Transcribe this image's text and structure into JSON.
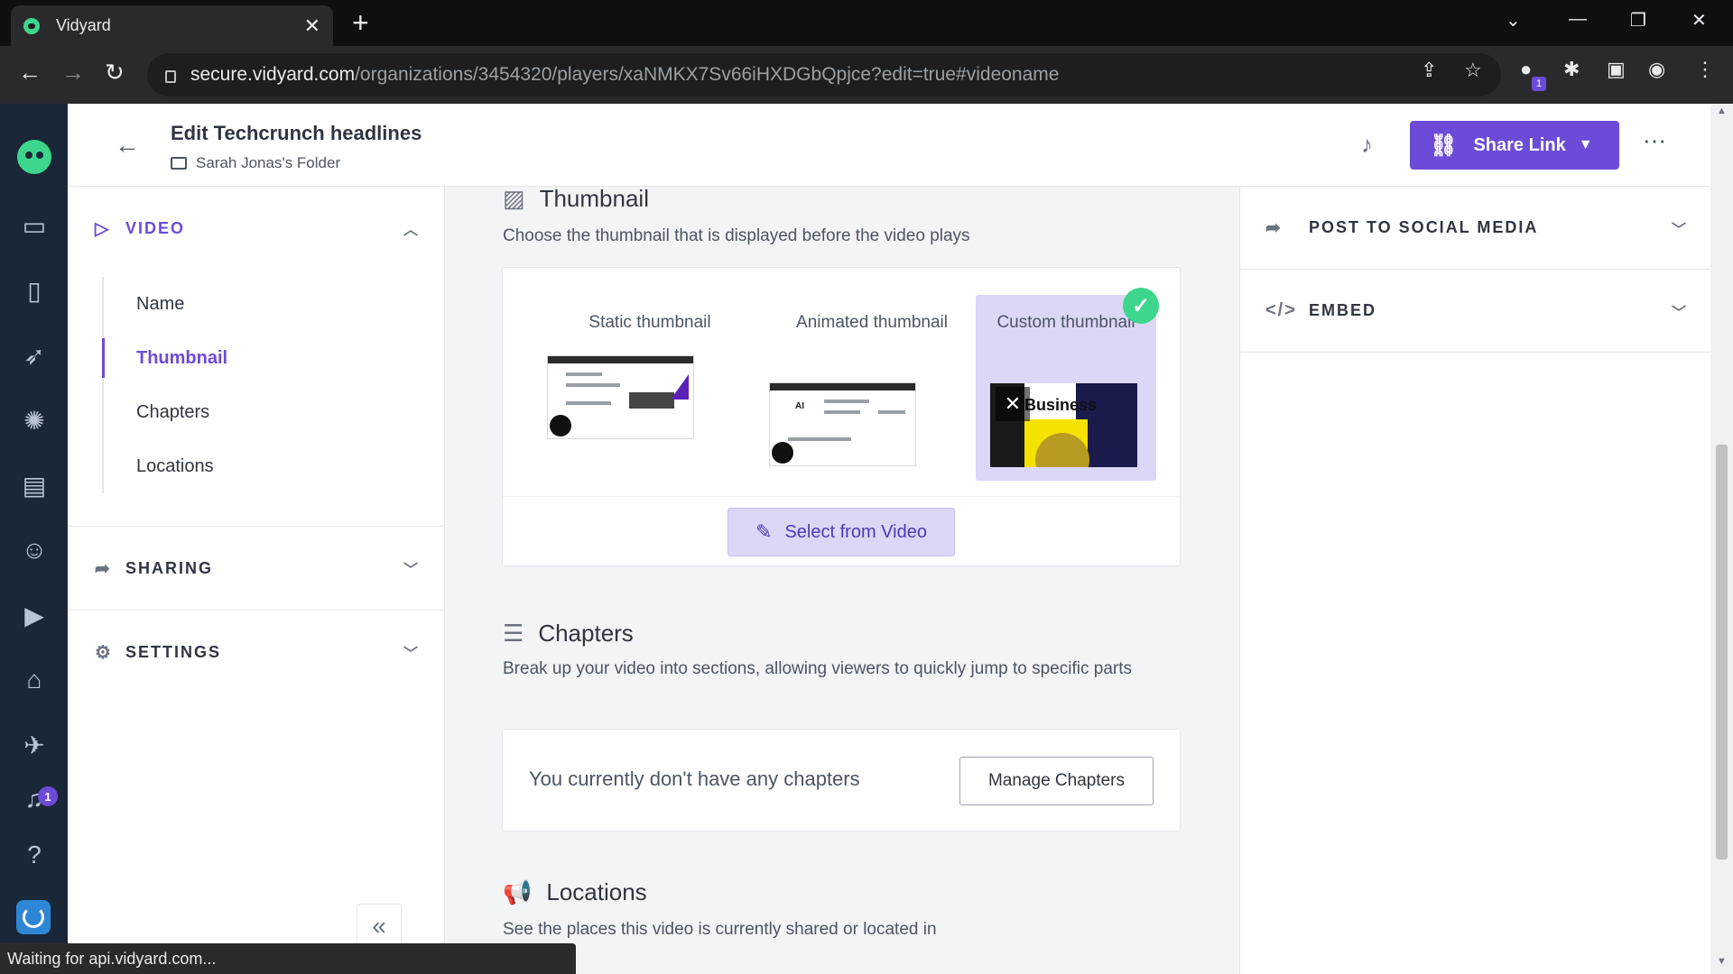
{
  "browser": {
    "tab_title": "Vidyard",
    "tab_close": "✕",
    "new_tab": "+",
    "url_host": "secure.vidyard.com",
    "url_path": "/organizations/3454320/players/xaNMKX7Sv66iHXDGbQpjce?edit=true#videoname",
    "extension_badge": "1",
    "status_text": "Waiting for api.vidyard.com..."
  },
  "header": {
    "title": "Edit Techcrunch headlines",
    "folder": "Sarah Jonas's Folder",
    "share_label": "Share Link",
    "more": "⋯"
  },
  "rail": {
    "notification_count": "1"
  },
  "left_panel": {
    "video_label": "VIDEO",
    "video_items": [
      {
        "label": "Name"
      },
      {
        "label": "Thumbnail"
      },
      {
        "label": "Chapters"
      },
      {
        "label": "Locations"
      }
    ],
    "sharing_label": "SHARING",
    "settings_label": "SETTINGS"
  },
  "thumbnail": {
    "title": "Thumbnail",
    "description": "Choose the thumbnail that is displayed before the video plays",
    "static_label": "Static thumbnail",
    "animated_label": "Animated thumbnail",
    "custom_label": "Custom thumbnail",
    "custom_image_text": "Business",
    "select_button": "Select from Video"
  },
  "chapters": {
    "title": "Chapters",
    "description": "Break up your video into sections, allowing viewers to quickly jump to specific parts",
    "empty_text": "You currently don't have any chapters",
    "manage_button": "Manage Chapters"
  },
  "locations": {
    "title": "Locations",
    "description": "See the places this video is currently shared or located in"
  },
  "right_panel": {
    "social_label": "POST TO SOCIAL MEDIA",
    "embed_label": "EMBED"
  },
  "colors": {
    "accent": "#6c4bd8",
    "rail": "#1a2738",
    "success": "#3dd68c"
  }
}
